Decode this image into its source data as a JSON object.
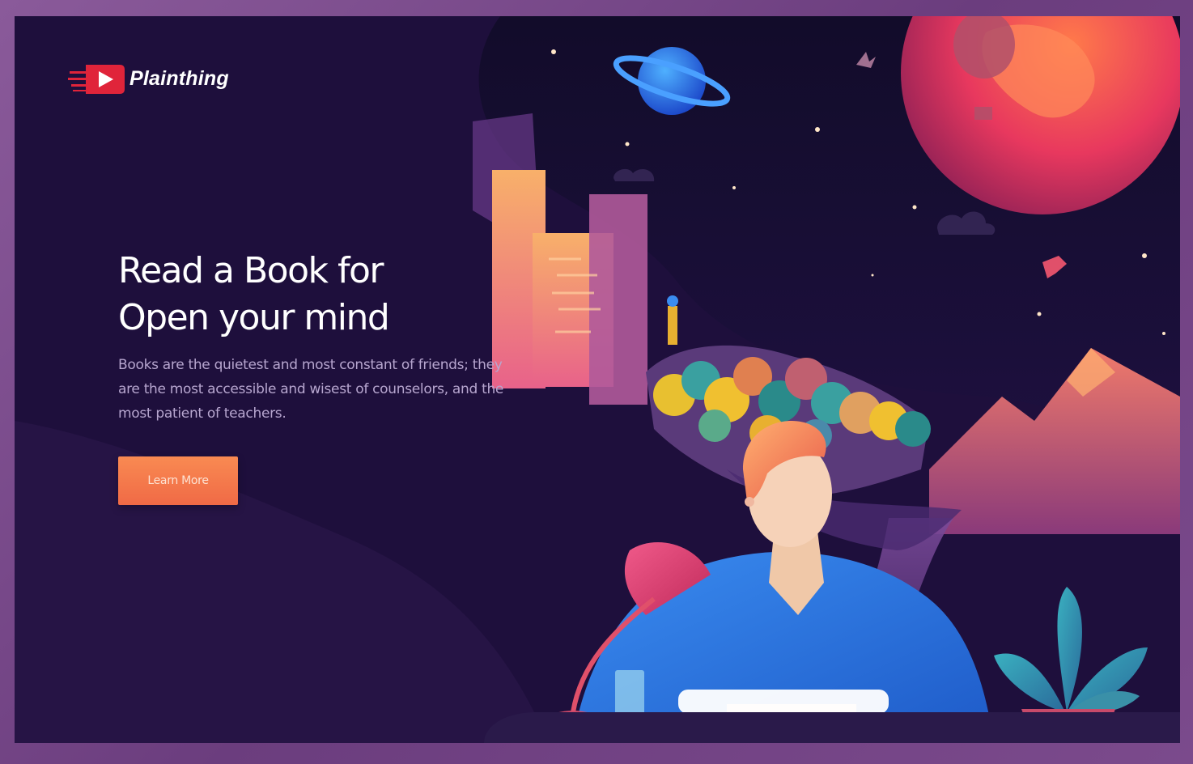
{
  "brand": {
    "name": "Plainthing",
    "logo_icon": "play-icon",
    "accent": "#e0243a"
  },
  "hero": {
    "title_line1": "Read a Book for",
    "title_line2": "Open your mind",
    "description": "Books are the quietest and most constant of friends; they are the most accessible and wisest of counselors, and the most patient of teachers.",
    "cta_label": "Learn More"
  },
  "colors": {
    "background": "#1e0f3c",
    "button_top": "#f98a52",
    "button_bottom": "#f06a46",
    "frame": "#7a4a8a"
  }
}
